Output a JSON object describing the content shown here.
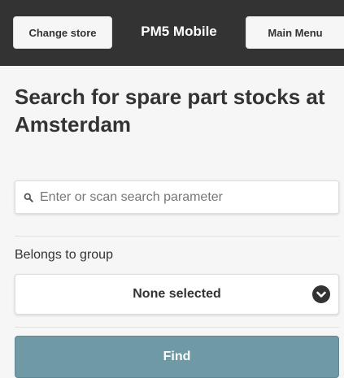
{
  "header": {
    "change_store_label": "Change store",
    "app_title": "PM5 Mobile",
    "main_menu_label": "Main Menu"
  },
  "page": {
    "title": "Search for spare part stocks at Amsterdam"
  },
  "search": {
    "icon": "search-icon",
    "value": "",
    "placeholder": "Enter or scan search parameter"
  },
  "group_filter": {
    "label": "Belongs to group",
    "selected": "None selected",
    "icon": "chevron-down-circle-icon"
  },
  "actions": {
    "find_label": "Find"
  },
  "colors": {
    "header_bg": "#333333",
    "page_bg": "#f6f6f6",
    "find_button_bg": "#6f99a4"
  }
}
